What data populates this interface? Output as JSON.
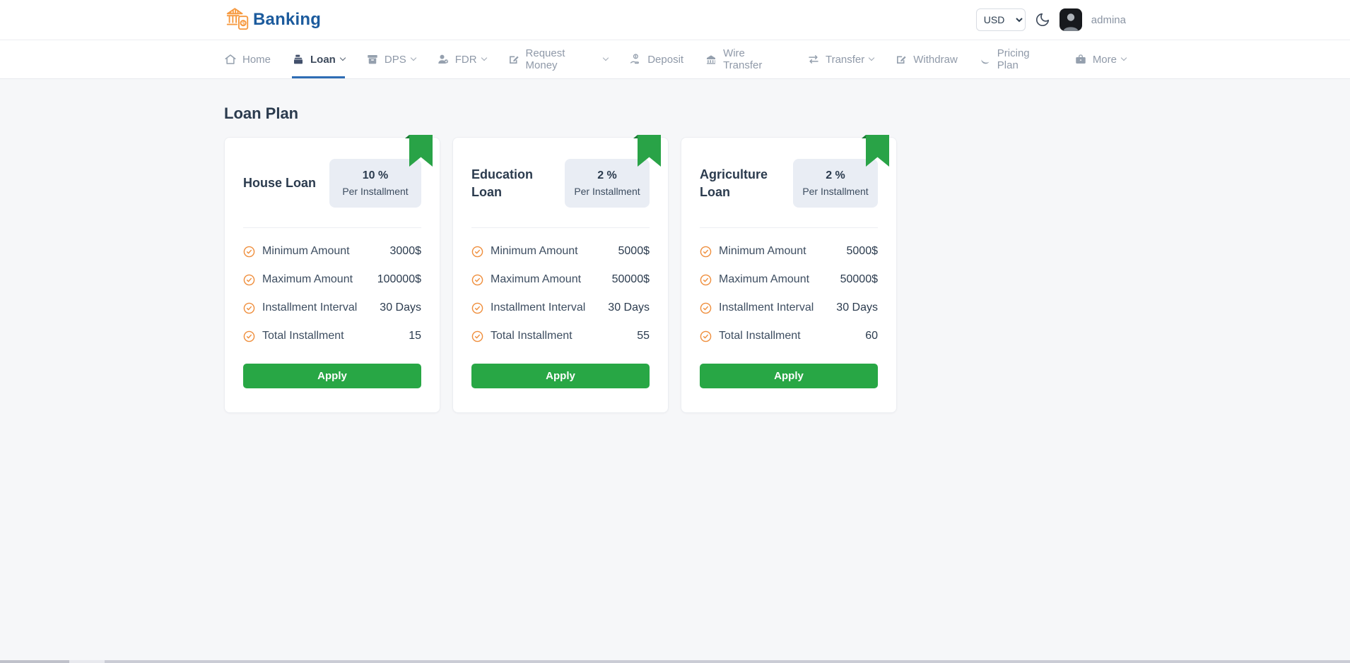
{
  "header": {
    "brand": "Banking",
    "currency": "USD",
    "username": "admina"
  },
  "nav": {
    "items": [
      {
        "label": "Home",
        "icon": "home-icon",
        "dropdown": false,
        "active": false
      },
      {
        "label": "Loan",
        "icon": "loan-icon",
        "dropdown": true,
        "active": true
      },
      {
        "label": "DPS",
        "icon": "dps-icon",
        "dropdown": true,
        "active": false
      },
      {
        "label": "FDR",
        "icon": "fdr-icon",
        "dropdown": true,
        "active": false
      },
      {
        "label": "Request Money",
        "icon": "request-money-icon",
        "dropdown": true,
        "active": false
      },
      {
        "label": "Deposit",
        "icon": "deposit-icon",
        "dropdown": false,
        "active": false
      },
      {
        "label": "Wire Transfer",
        "icon": "wire-transfer-icon",
        "dropdown": false,
        "active": false
      },
      {
        "label": "Transfer",
        "icon": "transfer-icon",
        "dropdown": true,
        "active": false
      },
      {
        "label": "Withdraw",
        "icon": "withdraw-icon",
        "dropdown": false,
        "active": false
      },
      {
        "label": "Pricing Plan",
        "icon": "pricing-plan-icon",
        "dropdown": false,
        "active": false
      },
      {
        "label": "More",
        "icon": "more-icon",
        "dropdown": true,
        "active": false
      }
    ]
  },
  "page": {
    "title": "Loan Plan"
  },
  "plans": [
    {
      "name": "House Loan",
      "rate": "10 %",
      "rate_caption": "Per Installment",
      "features": [
        {
          "label": "Minimum Amount",
          "value": "3000$"
        },
        {
          "label": "Maximum Amount",
          "value": "100000$"
        },
        {
          "label": "Installment Interval",
          "value": "30 Days"
        },
        {
          "label": "Total Installment",
          "value": "15"
        }
      ],
      "apply_label": "Apply"
    },
    {
      "name": "Education Loan",
      "rate": "2 %",
      "rate_caption": "Per Installment",
      "features": [
        {
          "label": "Minimum Amount",
          "value": "5000$"
        },
        {
          "label": "Maximum Amount",
          "value": "50000$"
        },
        {
          "label": "Installment Interval",
          "value": "30 Days"
        },
        {
          "label": "Total Installment",
          "value": "55"
        }
      ],
      "apply_label": "Apply"
    },
    {
      "name": "Agriculture Loan",
      "rate": "2 %",
      "rate_caption": "Per Installment",
      "features": [
        {
          "label": "Minimum Amount",
          "value": "5000$"
        },
        {
          "label": "Maximum Amount",
          "value": "50000$"
        },
        {
          "label": "Installment Interval",
          "value": "30 Days"
        },
        {
          "label": "Total Installment",
          "value": "60"
        }
      ],
      "apply_label": "Apply"
    }
  ],
  "colors": {
    "brand_blue": "#1c5b9d",
    "accent_blue": "#2e6db4",
    "logo_orange": "#f6993f",
    "check_orange": "#ef8e3c",
    "apply_green": "#28a745",
    "ribbon_green": "#29a347",
    "badge_bg": "#e9edf4",
    "page_bg": "#f6f7f9"
  }
}
